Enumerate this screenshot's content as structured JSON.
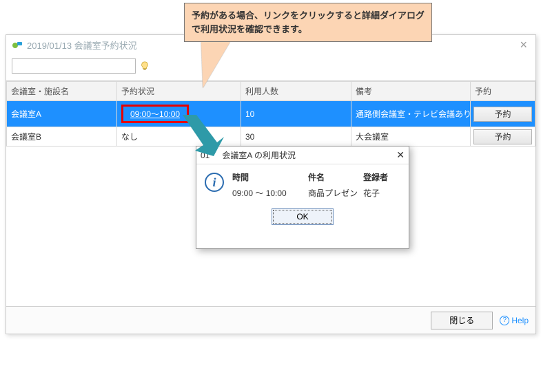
{
  "window": {
    "title": "2019/01/13 会議室予約状況"
  },
  "search": {
    "value": "",
    "placeholder": ""
  },
  "columns": {
    "room": "会議室・施設名",
    "status": "予約状況",
    "capacity": "利用人数",
    "note": "備考",
    "reserve": "予約"
  },
  "rows": [
    {
      "room": "会議室A",
      "status": "09:00～10:00",
      "capacity": "10",
      "note": "通路側会議室・テレビ会議あり",
      "reserve": "予約",
      "link": true,
      "selected": true
    },
    {
      "room": "会議室B",
      "status": "なし",
      "capacity": "30",
      "note": "大会議室",
      "reserve": "予約",
      "link": false,
      "selected": false
    }
  ],
  "footer": {
    "close": "閉じる",
    "help": "Help"
  },
  "callout": "予約がある場合、リンクをクリックすると詳細ダイアログで利用状況を確認できます。",
  "dialog": {
    "title_prefix": "01",
    "title": "会議室A の利用状況",
    "headers": {
      "time": "時間",
      "subject": "件名",
      "registrant": "登録者"
    },
    "row": {
      "time": "09:00 ～ 10:00",
      "subject": "商品プレゼン",
      "registrant": "花子"
    },
    "ok": "OK"
  }
}
